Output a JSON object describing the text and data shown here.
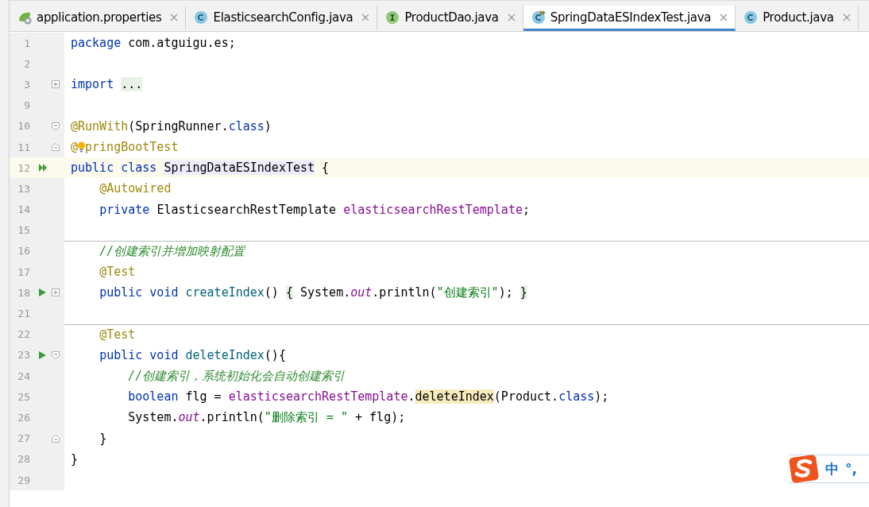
{
  "tabs": [
    {
      "label": "application.properties",
      "kind": "spring",
      "selected": false
    },
    {
      "label": "ElasticsearchConfig.java",
      "kind": "class",
      "selected": false
    },
    {
      "label": "ProductDao.java",
      "kind": "interface",
      "selected": false
    },
    {
      "label": "SpringDataESIndexTest.java",
      "kind": "test",
      "selected": true
    },
    {
      "label": "Product.java",
      "kind": "class",
      "selected": false
    }
  ],
  "editor": {
    "lines": [
      {
        "number": "1",
        "tokens": [
          {
            "kind": "keyword",
            "text": "package"
          },
          {
            "kind": "plain",
            "text": " com.atguigu.es;"
          }
        ]
      },
      {
        "number": "2"
      },
      {
        "number": "3",
        "gutter_icons": [
          {
            "kind": "fold-expand"
          }
        ],
        "tokens": [
          {
            "kind": "keyword",
            "text": "import"
          },
          {
            "kind": "fold",
            "text": " ..."
          }
        ]
      },
      {
        "number": "9"
      },
      {
        "number": "10",
        "gutter_icons": [
          {
            "kind": "fold-start"
          }
        ],
        "tokens": [
          {
            "kind": "annotation",
            "text": "@RunWith"
          },
          {
            "kind": "plain",
            "text": "(SpringRunner."
          },
          {
            "kind": "keyword",
            "text": "class"
          },
          {
            "kind": "plain",
            "text": ")"
          }
        ]
      },
      {
        "number": "11",
        "gutter_icons": [
          {
            "kind": "fold-end"
          }
        ],
        "tokens": [
          {
            "kind": "annotation",
            "text": "@"
          },
          {
            "kind": "bulb"
          },
          {
            "kind": "annotation",
            "text": "pringBootTest"
          }
        ]
      },
      {
        "number": "12",
        "current": true,
        "gutter_icons": [
          {
            "kind": "run-all"
          }
        ],
        "tokens": [
          {
            "kind": "keyword",
            "text": "public class "
          },
          {
            "kind": "ident",
            "text": "SpringDataESIndexTest"
          },
          {
            "kind": "plain",
            "text": " {"
          }
        ]
      },
      {
        "number": "13",
        "tokens": [
          {
            "kind": "annotation",
            "text": "    @Autowired"
          }
        ]
      },
      {
        "number": "14",
        "tokens": [
          {
            "kind": "keyword",
            "text": "    private"
          },
          {
            "kind": "plain",
            "text": " ElasticsearchRestTemplate "
          },
          {
            "kind": "field",
            "text": "elasticsearchRestTemplate"
          },
          {
            "kind": "plain",
            "text": ";"
          }
        ]
      },
      {
        "number": "15"
      },
      {
        "number": "16",
        "separator_above": true,
        "tokens": [
          {
            "kind": "comment",
            "text": "    //创建索引并增加映射配置"
          }
        ]
      },
      {
        "number": "17",
        "tokens": [
          {
            "kind": "annotation",
            "text": "    @Test"
          }
        ]
      },
      {
        "number": "18",
        "gutter_icons": [
          {
            "kind": "run"
          },
          {
            "kind": "fold-expand"
          }
        ],
        "tokens": [
          {
            "kind": "keyword",
            "text": "    public void "
          },
          {
            "kind": "method",
            "text": "createIndex"
          },
          {
            "kind": "plain",
            "text": "() "
          },
          {
            "kind": "fold",
            "text": "{ "
          },
          {
            "kind": "plain",
            "text": "System."
          },
          {
            "kind": "static",
            "text": "out"
          },
          {
            "kind": "plain",
            "text": ".println("
          },
          {
            "kind": "string",
            "text": "\"创建索引\""
          },
          {
            "kind": "plain",
            "text": ");"
          },
          {
            "kind": "fold",
            "text": " }"
          }
        ]
      },
      {
        "number": "21"
      },
      {
        "number": "22",
        "separator_above": true,
        "tokens": [
          {
            "kind": "annotation",
            "text": "    @Test"
          }
        ]
      },
      {
        "number": "23",
        "gutter_icons": [
          {
            "kind": "run"
          },
          {
            "kind": "fold-start"
          }
        ],
        "tokens": [
          {
            "kind": "keyword",
            "text": "    public void "
          },
          {
            "kind": "method",
            "text": "deleteIndex"
          },
          {
            "kind": "plain",
            "text": "(){"
          }
        ]
      },
      {
        "number": "24",
        "tokens": [
          {
            "kind": "comment",
            "text": "        //创建索引，系统初始化会自动创建索引"
          }
        ]
      },
      {
        "number": "25",
        "tokens": [
          {
            "kind": "keyword",
            "text": "        boolean"
          },
          {
            "kind": "plain",
            "text": " flg = "
          },
          {
            "kind": "field",
            "text": "elasticsearchRestTemplate"
          },
          {
            "kind": "plain",
            "text": "."
          },
          {
            "kind": "usage",
            "text": "deleteIndex"
          },
          {
            "kind": "plain",
            "text": "(Product."
          },
          {
            "kind": "keyword",
            "text": "class"
          },
          {
            "kind": "plain",
            "text": ");"
          }
        ]
      },
      {
        "number": "26",
        "tokens": [
          {
            "kind": "plain",
            "text": "        System."
          },
          {
            "kind": "static",
            "text": "out"
          },
          {
            "kind": "plain",
            "text": ".println("
          },
          {
            "kind": "string",
            "text": "\"删除索引 = \""
          },
          {
            "kind": "plain",
            "text": " + flg);"
          }
        ]
      },
      {
        "number": "27",
        "gutter_icons": [
          {
            "kind": "fold-end"
          }
        ],
        "tokens": [
          {
            "kind": "plain",
            "text": "    }"
          }
        ]
      },
      {
        "number": "28",
        "tokens": [
          {
            "kind": "plain",
            "text": "}"
          }
        ]
      },
      {
        "number": "29"
      }
    ]
  },
  "ime_bar": {
    "mode": "中",
    "punctuation": "°,"
  }
}
